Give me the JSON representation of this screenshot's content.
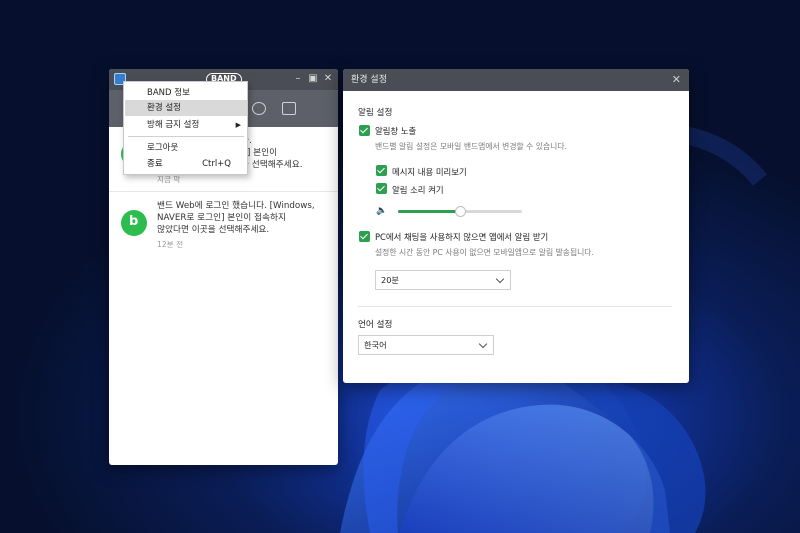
{
  "band_window": {
    "logo": "BAND",
    "notifications": [
      {
        "message": "...했습니다. ...그인] 본인이 ...을 선택해주세요.",
        "msg_line1": "했습니다.",
        "msg_line2": "그인] 본인이",
        "msg_line3": "을 선택해주세요.",
        "time": "지금 막"
      },
      {
        "message": "밴드 Web에 로그인 했습니다. [Windows, NAVER로 로그인] 본인이 접속하지 않았다면 이곳을 선택해주세요.",
        "msg_line1": "밴드 Web에 로그인 했습니다. [Windows,",
        "msg_line2": "NAVER로 로그인] 본인이 접속하지",
        "msg_line3": "않았다면 이곳을 선택해주세요.",
        "time": "12분 전"
      }
    ]
  },
  "context_menu": {
    "items": [
      {
        "label": "BAND 정보"
      },
      {
        "label": "환경 설정"
      },
      {
        "label": "방해 금지 설정"
      },
      {
        "label": "로그아웃"
      },
      {
        "label": "종료",
        "shortcut": "Ctrl+Q"
      }
    ]
  },
  "settings": {
    "title": "환경 설정",
    "notification_heading": "알림 설정",
    "show_popup": {
      "label": "알림창 노출",
      "checked": true,
      "description": "밴드별 알림 설정은 모바일 밴드앱에서 변경할 수 있습니다."
    },
    "preview": {
      "label": "메시지 내용 미리보기",
      "checked": true
    },
    "sound": {
      "label": "알림 소리 켜기",
      "checked": true
    },
    "volume_level": 0.5,
    "pc_inactive": {
      "label": "PC에서 채팅을 사용하지 않으면 앱에서 알림 받기",
      "checked": true,
      "description": "설정한 시간 동안 PC 사용이 없으면 모바일앱으로 알림 발송됩니다."
    },
    "delay_select": {
      "value": "20분"
    },
    "language_heading": "언어 설정",
    "language_select": {
      "value": "한국어"
    }
  },
  "colors": {
    "accent": "#2e9e4f",
    "titlebar": "#4a4d55",
    "avatar": "#2dbd4e"
  }
}
